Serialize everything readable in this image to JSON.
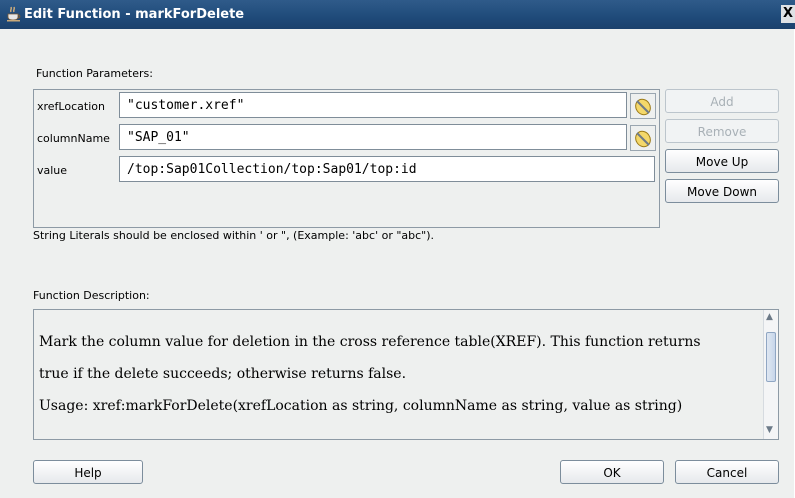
{
  "window": {
    "title": "Edit Function - markForDelete",
    "close_glyph": "X"
  },
  "params_section": {
    "label": "Function Parameters:"
  },
  "params": [
    {
      "name": "xrefLocation",
      "value": "\"customer.xref\""
    },
    {
      "name": "columnName",
      "value": "\"SAP_01\""
    },
    {
      "name": "value",
      "value": "/top:Sap01Collection/top:Sap01/top:id"
    }
  ],
  "side_buttons": {
    "add": "Add",
    "remove": "Remove",
    "move_up": "Move Up",
    "move_down": "Move Down"
  },
  "hint": "String Literals should be enclosed within ' or \", (Example: 'abc' or \"abc\").",
  "description_section": {
    "label": "Function Description:",
    "lines": [
      "Mark the column value for deletion in the cross reference table(XREF). This function returns",
      "true if the delete succeeds; otherwise returns false.",
      "Usage: xref:markForDelete(xrefLocation as string, columnName as string, value as string)"
    ]
  },
  "footer": {
    "help": "Help",
    "ok": "OK",
    "cancel": "Cancel"
  },
  "colors": {
    "title_bar": "#1f4a79",
    "dialog_bg": "#eef0ef",
    "disabled_text": "#a8b0b6"
  }
}
